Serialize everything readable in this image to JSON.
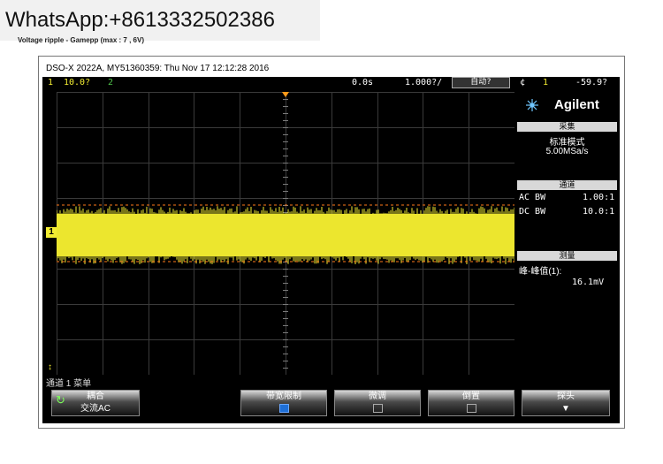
{
  "watermark": "WhatsApp:+8613332502386",
  "caption": "Voltage ripple - Gamepp (max : 7 , 6V)",
  "scope": {
    "title": "DSO-X 2022A, MY51360359: Thu Nov 17 12:12:28 2016",
    "top": {
      "ch1_num": "1",
      "ch1_scale": "10.0?",
      "ch2_num": "2",
      "time_delay": "0.0s",
      "time_scale": "1.000?/",
      "run_mode": "自动?",
      "trigger_icon": "¢",
      "trigger_ch": "1",
      "trigger_level": "-59.9?"
    },
    "brand": "Agilent",
    "acquire": {
      "header": "采集",
      "mode": "标准模式",
      "rate": "5.00MSa/s"
    },
    "channels": {
      "header": "通道",
      "rows": [
        {
          "label": "AC BW",
          "value": "1.00:1",
          "color": "#f2ec32"
        },
        {
          "label": "DC BW",
          "value": "10.0:1",
          "color": "#4ec04a"
        }
      ]
    },
    "measure": {
      "header": "测量",
      "label": "峰-峰值(1):",
      "value": "16.1mV"
    },
    "status_line": "通道 1 菜单",
    "softkeys": [
      {
        "label": "耦合",
        "value": "交流AC"
      },
      {
        "label": "带宽限制"
      },
      {
        "label": "微调"
      },
      {
        "label": "倒置"
      },
      {
        "label": "探头"
      }
    ],
    "marker_ground": "1",
    "trace_color": "#f2ec32",
    "cursor_color": "#ff7a1a"
  }
}
